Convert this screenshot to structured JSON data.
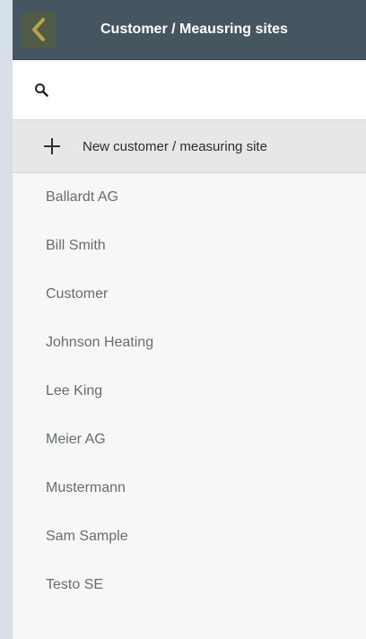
{
  "header": {
    "title": "Customer / Meausring sites",
    "back_icon": "chevron-left-icon"
  },
  "search": {
    "placeholder": "",
    "value": "",
    "icon": "search-icon"
  },
  "new_item": {
    "label": "New customer / measuring site",
    "icon": "plus-icon"
  },
  "customers": [
    "Ballardt AG",
    "Bill Smith",
    "Customer",
    "Johnson Heating",
    "Lee King",
    "Meier AG",
    "Mustermann",
    "Sam Sample",
    "Testo SE"
  ],
  "colors": {
    "header_bg": "#465661",
    "back_accent": "#b8a24a",
    "list_text": "#666d73"
  }
}
